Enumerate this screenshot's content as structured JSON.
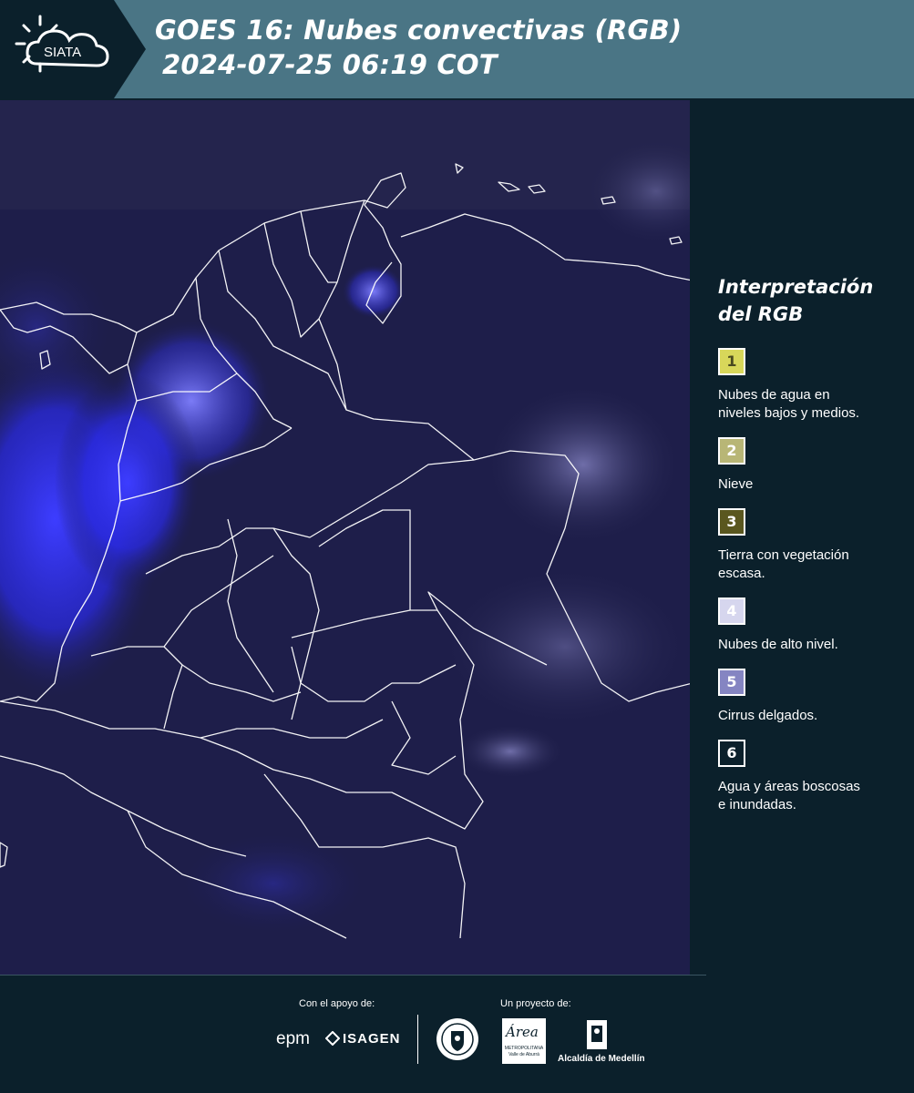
{
  "header": {
    "logo_text": "SIATA",
    "title_line1": "GOES 16: Nubes convectivas (RGB)",
    "title_line2": "2024-07-25 06:19 COT"
  },
  "legend": {
    "title_line1": "Interpretación",
    "title_line2": "del RGB",
    "items": [
      {
        "number": "1",
        "color": "#d8d75a",
        "text_color": "#4a4a20",
        "line1": "Nubes de agua en",
        "line2": "niveles bajos y medios."
      },
      {
        "number": "2",
        "color": "#b8b676",
        "text_color": "#ffffff",
        "line1": "Nieve",
        "line2": ""
      },
      {
        "number": "3",
        "color": "#5a571f",
        "text_color": "#ffffff",
        "line1": "Tierra con vegetación",
        "line2": "escasa."
      },
      {
        "number": "4",
        "color": "#d6d6ee",
        "text_color": "#ffffff",
        "line1": "Nubes de alto nivel.",
        "line2": ""
      },
      {
        "number": "5",
        "color": "#8585c2",
        "text_color": "#ffffff",
        "line1": "Cirrus delgados.",
        "line2": ""
      },
      {
        "number": "6",
        "color": "#0b202b",
        "text_color": "#ffffff",
        "line1": "Agua y áreas boscosas",
        "line2": "e inundadas."
      }
    ]
  },
  "footer": {
    "support_label": "Con el apoyo de:",
    "project_label": "Un proyecto de:",
    "sponsor_epm": "epm",
    "sponsor_isagen": "ISAGEN",
    "area_logo_text": "Área",
    "area_logo_sub": "METROPOLITANA Valle de Aburrá",
    "alcaldia": "Alcaldía de Medellín"
  },
  "colors": {
    "header_bg": "#4a7585",
    "page_bg": "#0b202b",
    "map_base": "#1c1c45",
    "cloud_blue": "#3b3bff"
  },
  "icons": [
    "sun-cloud-logo-icon",
    "isagen-diamond-icon",
    "medellin-seal-icon",
    "alcaldia-building-icon"
  ]
}
